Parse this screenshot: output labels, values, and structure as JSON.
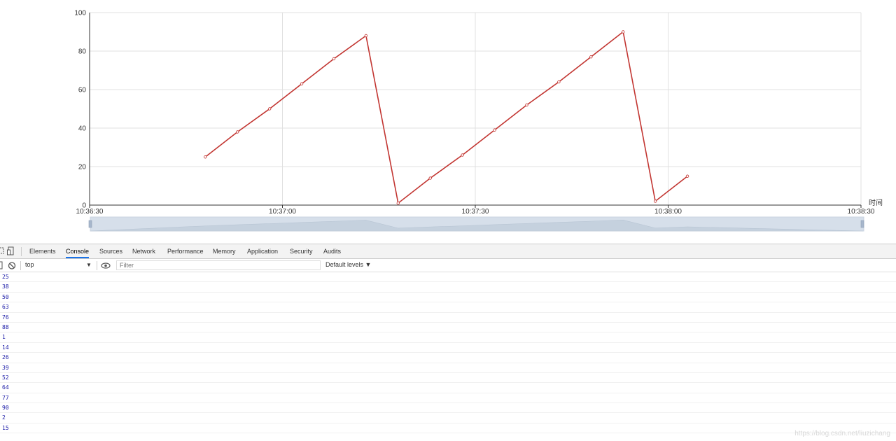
{
  "chart_data": {
    "type": "line",
    "x": [
      "10:36:48",
      "10:36:53",
      "10:36:58",
      "10:37:03",
      "10:37:08",
      "10:37:13",
      "10:37:18",
      "10:37:23",
      "10:37:28",
      "10:37:33",
      "10:37:38",
      "10:37:43",
      "10:37:48",
      "10:37:53",
      "10:37:58",
      "10:38:03"
    ],
    "series": [
      {
        "values": [
          25,
          38,
          50,
          63,
          76,
          88,
          1,
          14,
          26,
          39,
          52,
          64,
          77,
          90,
          2,
          15
        ],
        "color": "#c23531"
      }
    ],
    "xlim": [
      "10:36:30",
      "10:38:30"
    ],
    "xticks": [
      "10:36:30",
      "10:37:00",
      "10:37:30",
      "10:38:00",
      "10:38:30"
    ],
    "ylim": [
      0,
      100
    ],
    "yticks": [
      "0",
      "20",
      "40",
      "60",
      "80",
      "100"
    ],
    "xlabel": "时间",
    "grid": true,
    "datazoom": true
  },
  "devtools": {
    "tabs": [
      {
        "label": "Elements",
        "active": false
      },
      {
        "label": "Console",
        "active": true
      },
      {
        "label": "Sources",
        "active": false
      },
      {
        "label": "Network",
        "active": false
      },
      {
        "label": "Performance",
        "active": false
      },
      {
        "label": "Memory",
        "active": false
      },
      {
        "label": "Application",
        "active": false
      },
      {
        "label": "Security",
        "active": false
      },
      {
        "label": "Audits",
        "active": false
      }
    ],
    "context": "top",
    "filter_placeholder": "Filter",
    "levels": "Default levels ▼",
    "console_lines": [
      "25",
      "38",
      "50",
      "63",
      "76",
      "88",
      "1",
      "14",
      "26",
      "39",
      "52",
      "64",
      "77",
      "90",
      "2",
      "15"
    ]
  },
  "watermark": "https://blog.csdn.net/liuzichang"
}
